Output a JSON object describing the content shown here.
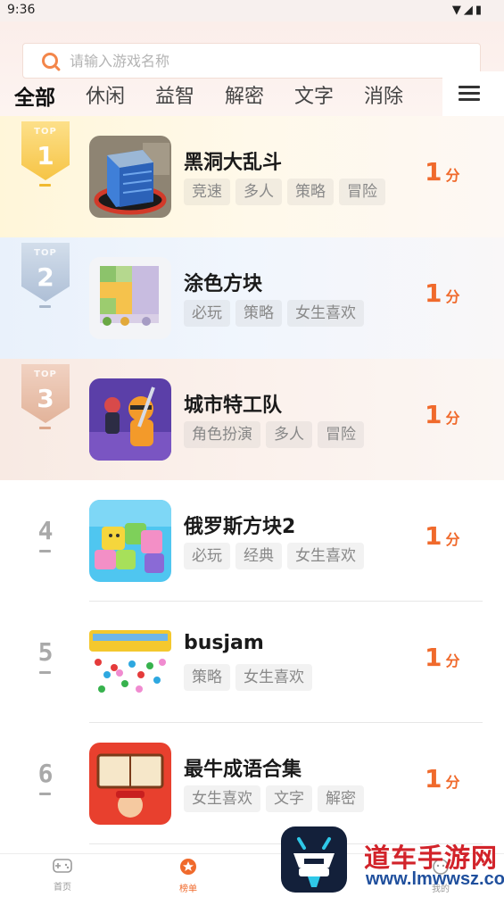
{
  "status_bar": {
    "time": "9:36"
  },
  "search": {
    "placeholder": "请输入游戏名称",
    "value": ""
  },
  "tabs": [
    {
      "label": "全部",
      "active": true
    },
    {
      "label": "休闲"
    },
    {
      "label": "益智"
    },
    {
      "label": "解密"
    },
    {
      "label": "文字"
    },
    {
      "label": "消除"
    }
  ],
  "menu": {
    "icon": "hamburger-menu-icon"
  },
  "ranking": [
    {
      "rank": "1",
      "top_label": "TOP",
      "name": "黑洞大乱斗",
      "tags": [
        "竞速",
        "多人",
        "策略",
        "冒险"
      ],
      "score": "1",
      "unit": "分",
      "icon": "black-hole-game-icon"
    },
    {
      "rank": "2",
      "top_label": "TOP",
      "name": "涂色方块",
      "tags": [
        "必玩",
        "策略",
        "女生喜欢"
      ],
      "score": "1",
      "unit": "分",
      "icon": "color-block-game-icon"
    },
    {
      "rank": "3",
      "top_label": "TOP",
      "name": "城市特工队",
      "tags": [
        "角色扮演",
        "多人",
        "冒险"
      ],
      "score": "1",
      "unit": "分",
      "icon": "city-agent-game-icon"
    },
    {
      "rank": "4",
      "name": "俄罗斯方块2",
      "tags": [
        "必玩",
        "经典",
        "女生喜欢"
      ],
      "score": "1",
      "unit": "分",
      "icon": "tetris-game-icon"
    },
    {
      "rank": "5",
      "name": "busjam",
      "tags": [
        "策略",
        "女生喜欢"
      ],
      "score": "1",
      "unit": "分",
      "icon": "bus-jam-game-icon"
    },
    {
      "rank": "6",
      "name": "最牛成语合集",
      "tags": [
        "女生喜欢",
        "文字",
        "解密"
      ],
      "score": "1",
      "unit": "分",
      "icon": "idiom-game-icon"
    }
  ],
  "bottom_nav": [
    {
      "label": "首页",
      "icon": "gamepad-icon"
    },
    {
      "label": "榜单",
      "icon": "ranking-icon",
      "active": true
    },
    {
      "label": "我的",
      "icon": "profile-icon"
    }
  ],
  "watermark": {
    "title": "道车手游网",
    "url": "www.lmwwsz.com"
  },
  "colors": {
    "accent": "#f06a2c",
    "gold": "#f6c445",
    "silver": "#b9c8dc",
    "bronze": "#e6b8a0"
  }
}
